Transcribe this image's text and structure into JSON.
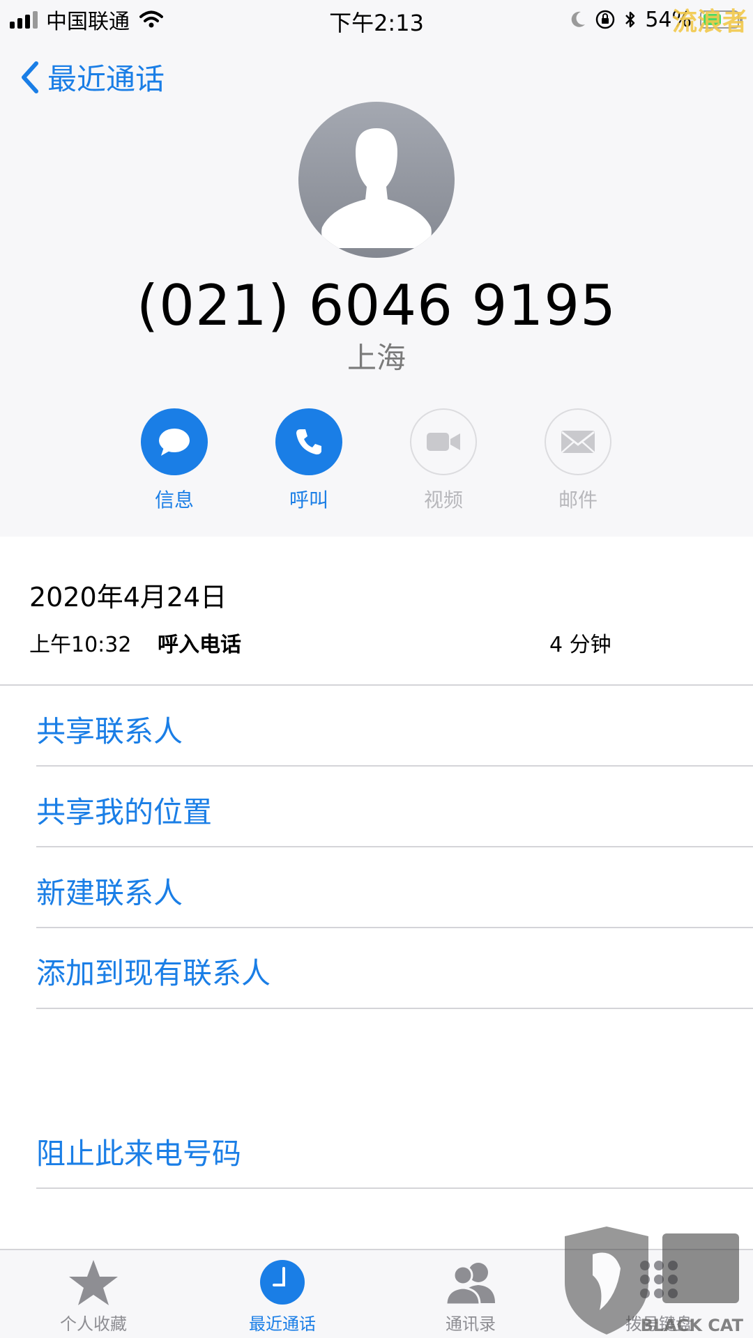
{
  "status_bar": {
    "carrier": "中国联通",
    "time": "下午2:13",
    "battery": "54%",
    "battery_level": 0.54,
    "icons": [
      "signal-icon",
      "wifi-icon",
      "moon-icon",
      "rotation-lock-icon",
      "bluetooth-icon",
      "battery-icon"
    ]
  },
  "nav": {
    "back_label": "最近通话"
  },
  "contact": {
    "number": "(021) 6046 9195",
    "location": "上海"
  },
  "actions": [
    {
      "label": "信息",
      "icon": "message-icon",
      "enabled": true
    },
    {
      "label": "呼叫",
      "icon": "phone-icon",
      "enabled": true
    },
    {
      "label": "视频",
      "icon": "video-icon",
      "enabled": false
    },
    {
      "label": "邮件",
      "icon": "mail-icon",
      "enabled": false
    }
  ],
  "call": {
    "date": "2020年4月24日",
    "time": "上午10:32",
    "type": "呼入电话",
    "duration": "4 分钟"
  },
  "menu": {
    "share_contact": "共享联系人",
    "share_location": "共享我的位置",
    "new_contact": "新建联系人",
    "add_existing": "添加到现有联系人",
    "block": "阻止此来电号码"
  },
  "tabs": [
    {
      "label": "个人收藏",
      "icon": "star-icon",
      "active": false
    },
    {
      "label": "最近通话",
      "icon": "clock-icon",
      "active": true
    },
    {
      "label": "通讯录",
      "icon": "contacts-icon",
      "active": false
    },
    {
      "label": "拨号键盘",
      "icon": "keypad-icon",
      "active": false
    }
  ],
  "watermark": "流浪者",
  "brand": {
    "text": "BLACK CAT"
  },
  "colors": {
    "accent": "#1a7ee6",
    "inactive": "#8e8e93",
    "disabled": "#b7b7bb",
    "header_bg": "#f7f7f9"
  }
}
